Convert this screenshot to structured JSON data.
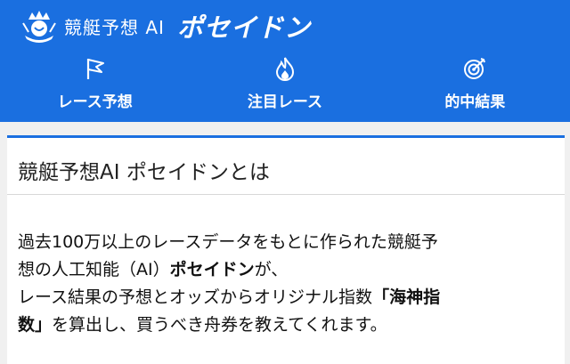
{
  "header": {
    "brand_text": "競艇予想 AI",
    "brand_name": "ポセイドン",
    "brand_icon": "trident-crown-logo",
    "background": "#1a6fe0"
  },
  "nav": {
    "items": [
      {
        "label": "レース予想",
        "icon": "flag-icon"
      },
      {
        "label": "注目レース",
        "icon": "flame-icon"
      },
      {
        "label": "的中結果",
        "icon": "target-icon"
      }
    ]
  },
  "article": {
    "title": "競艇予想AI ポセイドンとは",
    "line1": "過去100万以上のレースデータをもとに作られた競艇予",
    "line2_pre": "想の人工知能（AI）",
    "line2_bold": "ポセイドン",
    "line2_post": "が、",
    "line3_pre": "レース結果の予想とオッズからオリジナル指数",
    "line3_bold": "「海神指",
    "line4_bold": "数」",
    "line4_post": "を算出し、買うべき舟券を教えてくれます。"
  }
}
